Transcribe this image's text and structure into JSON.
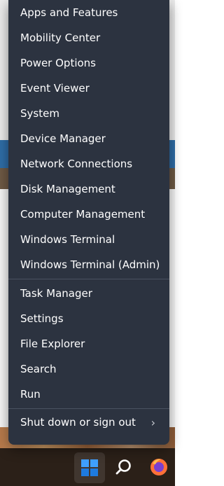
{
  "menu": {
    "items": [
      {
        "label": "Apps and Features"
      },
      {
        "label": "Mobility Center"
      },
      {
        "label": "Power Options"
      },
      {
        "label": "Event Viewer"
      },
      {
        "label": "System"
      },
      {
        "label": "Device Manager"
      },
      {
        "label": "Network Connections"
      },
      {
        "label": "Disk Management"
      },
      {
        "label": "Computer Management"
      },
      {
        "label": "Windows Terminal"
      },
      {
        "label": "Windows Terminal (Admin)"
      },
      {
        "label": "Task Manager"
      },
      {
        "label": "Settings"
      },
      {
        "label": "File Explorer"
      },
      {
        "label": "Search"
      },
      {
        "label": "Run"
      },
      {
        "label": "Shut down or sign out"
      }
    ],
    "submenu_icon": "chevron-right-icon"
  },
  "taskbar": {
    "icons": [
      "windows-start-icon",
      "search-icon",
      "firefox-icon"
    ]
  },
  "colors": {
    "menu_bg": "#2c3340",
    "menu_text": "#ffffff",
    "separator": "#4a5260",
    "taskbar_bg": "#2b2018"
  }
}
